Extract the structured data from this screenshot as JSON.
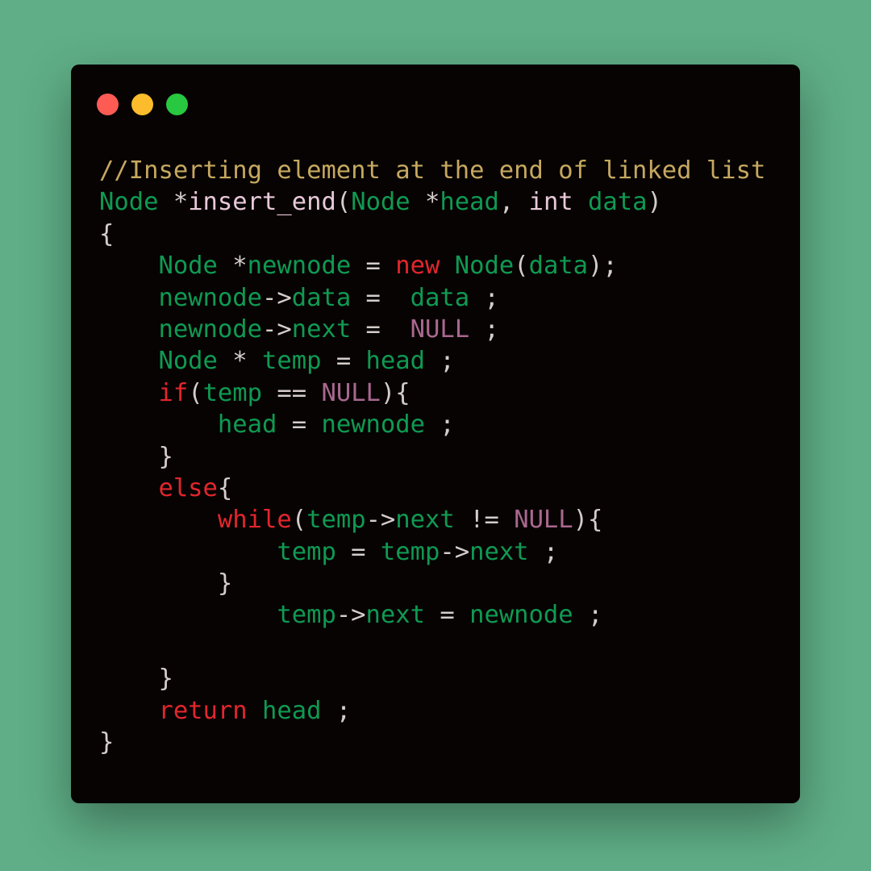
{
  "window": {
    "controls": [
      {
        "name": "close-button",
        "color": "#ff5b55"
      },
      {
        "name": "minimize-button",
        "color": "#fdbc2c"
      },
      {
        "name": "maximize-button",
        "color": "#28c840"
      }
    ]
  },
  "colors": {
    "background": "#5fae87",
    "window": "#070303",
    "comment": "#c6a860",
    "type": "#0f9a52",
    "keyword": "#e2262c",
    "null": "#a9688f",
    "function": "#e8c8d8",
    "punctuation": "#d5cdcb"
  },
  "code": {
    "lines": [
      [
        {
          "t": "comment",
          "v": "//Inserting element at the end of linked list"
        }
      ],
      [
        {
          "t": "type",
          "v": "Node"
        },
        {
          "t": "punc",
          "v": " *"
        },
        {
          "t": "func",
          "v": "insert_end"
        },
        {
          "t": "punc",
          "v": "("
        },
        {
          "t": "type",
          "v": "Node"
        },
        {
          "t": "punc",
          "v": " *"
        },
        {
          "t": "var",
          "v": "head"
        },
        {
          "t": "punc",
          "v": ", "
        },
        {
          "t": "func",
          "v": "int"
        },
        {
          "t": "punc",
          "v": " "
        },
        {
          "t": "var",
          "v": "data"
        },
        {
          "t": "punc",
          "v": ")"
        }
      ],
      [
        {
          "t": "punc",
          "v": "{"
        }
      ],
      [
        {
          "t": "punc",
          "v": "    "
        },
        {
          "t": "type",
          "v": "Node"
        },
        {
          "t": "punc",
          "v": " *"
        },
        {
          "t": "var",
          "v": "newnode"
        },
        {
          "t": "punc",
          "v": " = "
        },
        {
          "t": "kw",
          "v": "new"
        },
        {
          "t": "punc",
          "v": " "
        },
        {
          "t": "type",
          "v": "Node"
        },
        {
          "t": "punc",
          "v": "("
        },
        {
          "t": "var",
          "v": "data"
        },
        {
          "t": "punc",
          "v": ");"
        }
      ],
      [
        {
          "t": "punc",
          "v": "    "
        },
        {
          "t": "var",
          "v": "newnode"
        },
        {
          "t": "punc",
          "v": "->"
        },
        {
          "t": "var",
          "v": "data"
        },
        {
          "t": "punc",
          "v": " =  "
        },
        {
          "t": "var",
          "v": "data"
        },
        {
          "t": "punc",
          "v": " ;"
        }
      ],
      [
        {
          "t": "punc",
          "v": "    "
        },
        {
          "t": "var",
          "v": "newnode"
        },
        {
          "t": "punc",
          "v": "->"
        },
        {
          "t": "var",
          "v": "next"
        },
        {
          "t": "punc",
          "v": " =  "
        },
        {
          "t": "null",
          "v": "NULL"
        },
        {
          "t": "punc",
          "v": " ;"
        }
      ],
      [
        {
          "t": "punc",
          "v": "    "
        },
        {
          "t": "type",
          "v": "Node"
        },
        {
          "t": "punc",
          "v": " * "
        },
        {
          "t": "var",
          "v": "temp"
        },
        {
          "t": "punc",
          "v": " = "
        },
        {
          "t": "var",
          "v": "head"
        },
        {
          "t": "punc",
          "v": " ;"
        }
      ],
      [
        {
          "t": "punc",
          "v": "    "
        },
        {
          "t": "kw",
          "v": "if"
        },
        {
          "t": "punc",
          "v": "("
        },
        {
          "t": "var",
          "v": "temp"
        },
        {
          "t": "punc",
          "v": " == "
        },
        {
          "t": "null",
          "v": "NULL"
        },
        {
          "t": "punc",
          "v": "){"
        }
      ],
      [
        {
          "t": "punc",
          "v": "        "
        },
        {
          "t": "var",
          "v": "head"
        },
        {
          "t": "punc",
          "v": " = "
        },
        {
          "t": "var",
          "v": "newnode"
        },
        {
          "t": "punc",
          "v": " ;"
        }
      ],
      [
        {
          "t": "punc",
          "v": "    }"
        }
      ],
      [
        {
          "t": "punc",
          "v": "    "
        },
        {
          "t": "kw",
          "v": "else"
        },
        {
          "t": "punc",
          "v": "{"
        }
      ],
      [
        {
          "t": "punc",
          "v": "        "
        },
        {
          "t": "kw",
          "v": "while"
        },
        {
          "t": "punc",
          "v": "("
        },
        {
          "t": "var",
          "v": "temp"
        },
        {
          "t": "punc",
          "v": "->"
        },
        {
          "t": "var",
          "v": "next"
        },
        {
          "t": "punc",
          "v": " != "
        },
        {
          "t": "null",
          "v": "NULL"
        },
        {
          "t": "punc",
          "v": "){"
        }
      ],
      [
        {
          "t": "punc",
          "v": "            "
        },
        {
          "t": "var",
          "v": "temp"
        },
        {
          "t": "punc",
          "v": " = "
        },
        {
          "t": "var",
          "v": "temp"
        },
        {
          "t": "punc",
          "v": "->"
        },
        {
          "t": "var",
          "v": "next"
        },
        {
          "t": "punc",
          "v": " ;"
        }
      ],
      [
        {
          "t": "punc",
          "v": "        }"
        }
      ],
      [
        {
          "t": "punc",
          "v": "            "
        },
        {
          "t": "var",
          "v": "temp"
        },
        {
          "t": "punc",
          "v": "->"
        },
        {
          "t": "var",
          "v": "next"
        },
        {
          "t": "punc",
          "v": " = "
        },
        {
          "t": "var",
          "v": "newnode"
        },
        {
          "t": "punc",
          "v": " ;"
        }
      ],
      [],
      [
        {
          "t": "punc",
          "v": "    }"
        }
      ],
      [
        {
          "t": "punc",
          "v": "    "
        },
        {
          "t": "kw",
          "v": "return"
        },
        {
          "t": "punc",
          "v": " "
        },
        {
          "t": "var",
          "v": "head"
        },
        {
          "t": "punc",
          "v": " ;"
        }
      ],
      [
        {
          "t": "punc",
          "v": "}"
        }
      ]
    ]
  }
}
